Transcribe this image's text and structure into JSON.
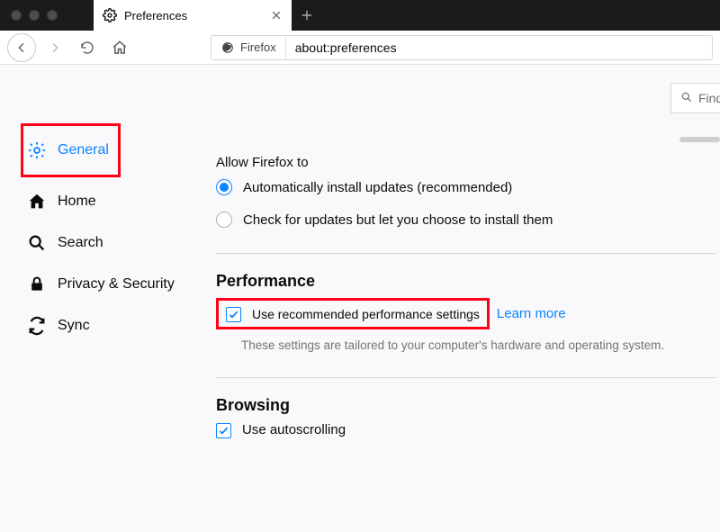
{
  "tab": {
    "title": "Preferences"
  },
  "identity": {
    "label": "Firefox"
  },
  "url": "about:preferences",
  "find": {
    "placeholder": "Find"
  },
  "sidebar": {
    "items": [
      {
        "label": "General"
      },
      {
        "label": "Home"
      },
      {
        "label": "Search"
      },
      {
        "label": "Privacy & Security"
      },
      {
        "label": "Sync"
      }
    ]
  },
  "updates": {
    "heading": "Allow Firefox to",
    "opt_auto": "Automatically install updates (recommended)",
    "opt_check": "Check for updates but let you choose to install them"
  },
  "performance": {
    "title": "Performance",
    "use_recommended": "Use recommended performance settings",
    "learn_more": "Learn more",
    "desc": "These settings are tailored to your computer's hardware and operating system."
  },
  "browsing": {
    "title": "Browsing",
    "autoscroll": "Use autoscrolling"
  }
}
